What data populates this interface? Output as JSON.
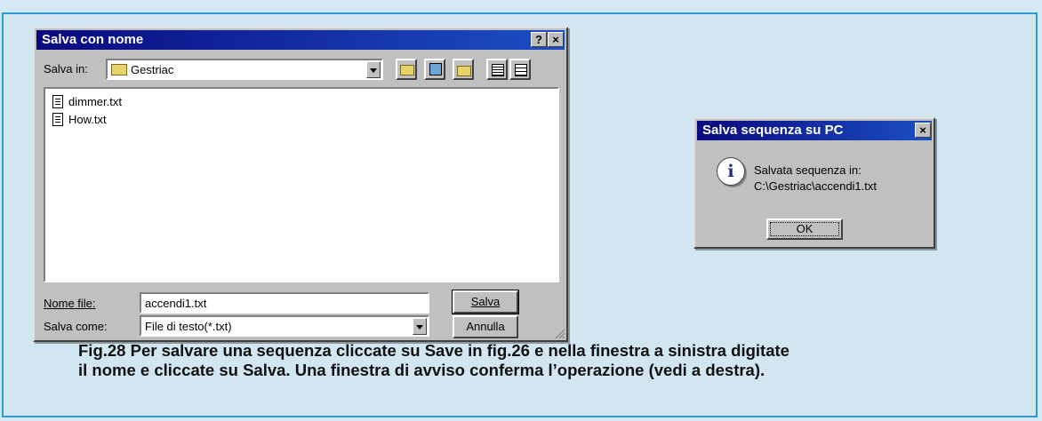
{
  "save_dialog": {
    "title": "Salva con nome",
    "help_glyph": "?",
    "close_glyph": "×",
    "save_in_label": "Salva in:",
    "save_in_value": "Gestriac",
    "files": [
      {
        "name": "dimmer.txt"
      },
      {
        "name": "How.txt"
      }
    ],
    "filename_label": "Nome file:",
    "filename_value": "accendi1.txt",
    "filetype_label": "Salva come:",
    "filetype_value": "File di testo(*.txt)",
    "save_button": "Salva",
    "cancel_button": "Annulla",
    "toolbar_icons": [
      "up-folder-icon",
      "desktop-icon",
      "new-folder-icon",
      "list-view-icon",
      "details-view-icon"
    ]
  },
  "confirm_dialog": {
    "title": "Salva sequenza su PC",
    "close_glyph": "×",
    "info_glyph": "i",
    "message_line1": "Salvata sequenza in:",
    "message_line2": "C:\\Gestriac\\accendi1.txt",
    "ok_button": "OK"
  },
  "caption": {
    "line1": "Fig.28 Per salvare una sequenza cliccate su Save in fig.26 e nella finestra a sinistra digitate",
    "line2": "il nome e cliccate su Salva. Una finestra di avviso conferma l’operazione (vedi a destra)."
  },
  "colors": {
    "frame_border": "#2d9bd2",
    "page_background": "#d2e6f1",
    "titlebar_start": "#0a0a80",
    "titlebar_end": "#1c4fc4",
    "window_face": "#c0c0c0"
  }
}
